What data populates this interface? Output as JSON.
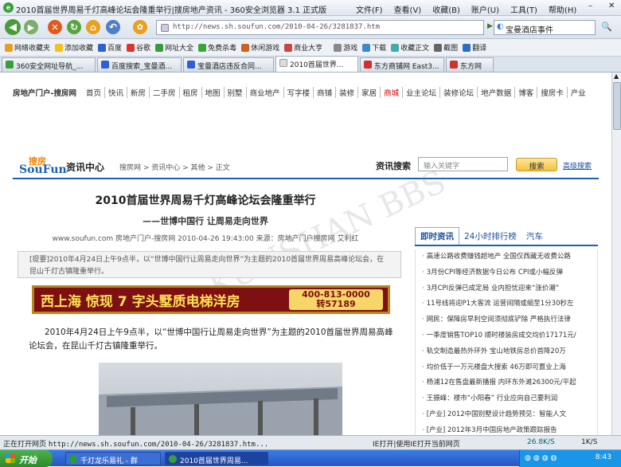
{
  "browser": {
    "title": "2010首届世界周易千灯高峰论坛会隆重举行|搜房地产资讯 - 360安全浏览器 3.1 正式版",
    "menu": [
      "文件(F)",
      "查看(V)",
      "收藏(B)",
      "账户(U)",
      "工具(T)",
      "帮助(H)"
    ],
    "address": "http://news.sh.soufun.com/2010-04-26/3281837.htm",
    "search_value": "宝曼酒店事件",
    "bookmarks": [
      "网络收藏夹",
      "添加收藏",
      "百度",
      "谷歌",
      "网址大全",
      "免费杀毒",
      "休闲游戏",
      "商业大亨",
      "游戏",
      "下载",
      "收藏正文",
      "截图",
      "翻译"
    ],
    "tabs": [
      "360安全网址导航_...",
      "百度搜索_宝曼酒...",
      "宝曼酒店违反合同...",
      "2010首届世界...",
      "东方商铺网 East3...",
      "东方网"
    ],
    "active_tab_index": 3,
    "status_text": "正在打开网页",
    "status_url": "http://news.sh.soufun.com/2010-04-26/3281837.htm...",
    "status_ie": "IE打开|使用IE打开当前网页",
    "download_speed": "26.8K/S",
    "page_count": "1K/S"
  },
  "site": {
    "nav_items": [
      "房地产门户-搜房网",
      "首页",
      "快讯",
      "新房",
      "二手房",
      "租房",
      "地图",
      "别墅",
      "商业地产",
      "写字楼",
      "商铺",
      "装修",
      "家居",
      "商城",
      "业主论坛",
      "装修论坛",
      "地产数据",
      "博客",
      "搜房卡",
      "产业"
    ],
    "logo_top": "搜房",
    "logo_bottom": "SouFun",
    "info_center": "资讯中心",
    "breadcrumb": "搜房网 > 资讯中心 > 其他 > 正文",
    "search_label": "资讯搜索",
    "search_placeholder": "输入关键字",
    "search_button": "搜索",
    "advanced_search": "高级搜索"
  },
  "article": {
    "title": "2010首届世界周易千灯高峰论坛会隆重举行",
    "subtitle": "——世博中国行 让周易走向世界",
    "meta": "www.soufun.com 房地产门户-搜房网 2010-04-26 19:43:00 来源：房地产门户搜房网 艾利红",
    "summary": "[提要]2010年4月24日上午9点半，以“世博中国行让周易走向世界”为主题的2010首届世界周易高峰论坛会，在昆山千灯古镇隆重举行。",
    "banner_main": "西上海 惊现 7 字头墅质电梯洋房",
    "banner_phone": "400-813-0000",
    "banner_ext": "转57189",
    "body": "2010年4月24日上午9点半，以“世博中国行让周易走向世界”为主题的2010首届世界周易高峰论坛会，在昆山千灯古镇隆重举行。",
    "watermark": "KUNSHAN BBS"
  },
  "panel": {
    "tabs": [
      "即时资讯",
      "24小时排行榜",
      "汽车"
    ],
    "items": [
      "高速公路收费赚钱超地产 全国仅西藏无收费公路",
      "3月份CPI等经济数据今日公布 CPI或小幅反弹",
      "3月CPI反弹已成定局 业内担忧迎来“涨价潮”",
      "11号线将迎P1大客流 运营间隔或缩至1分30秒左",
      "网民：保障房早利空间须彻底铲除 严格执行法律",
      "一季度销售TOP10 顺时楼装房成交均价17171元/",
      "轨交制造最热外环外 宝山地铁房总价首降20万",
      "均价低于一万元楼盘大搜索 46万即可置业上海",
      "杨浦12在售盘最新播报 内环东外滩26300元/平起",
      "王振峰：楼市“小阳春” 行业应向自己要利润",
      "[产业] 2012中国别墅设计趋势预见：智能人文",
      "[产业] 2012年3月中国房地产政策跟踪报告"
    ]
  },
  "taskbar": {
    "start": "开始",
    "items": [
      "千灯龙乐易礼 - 群",
      "2010首届世界周易..."
    ],
    "clock": "8:43"
  }
}
